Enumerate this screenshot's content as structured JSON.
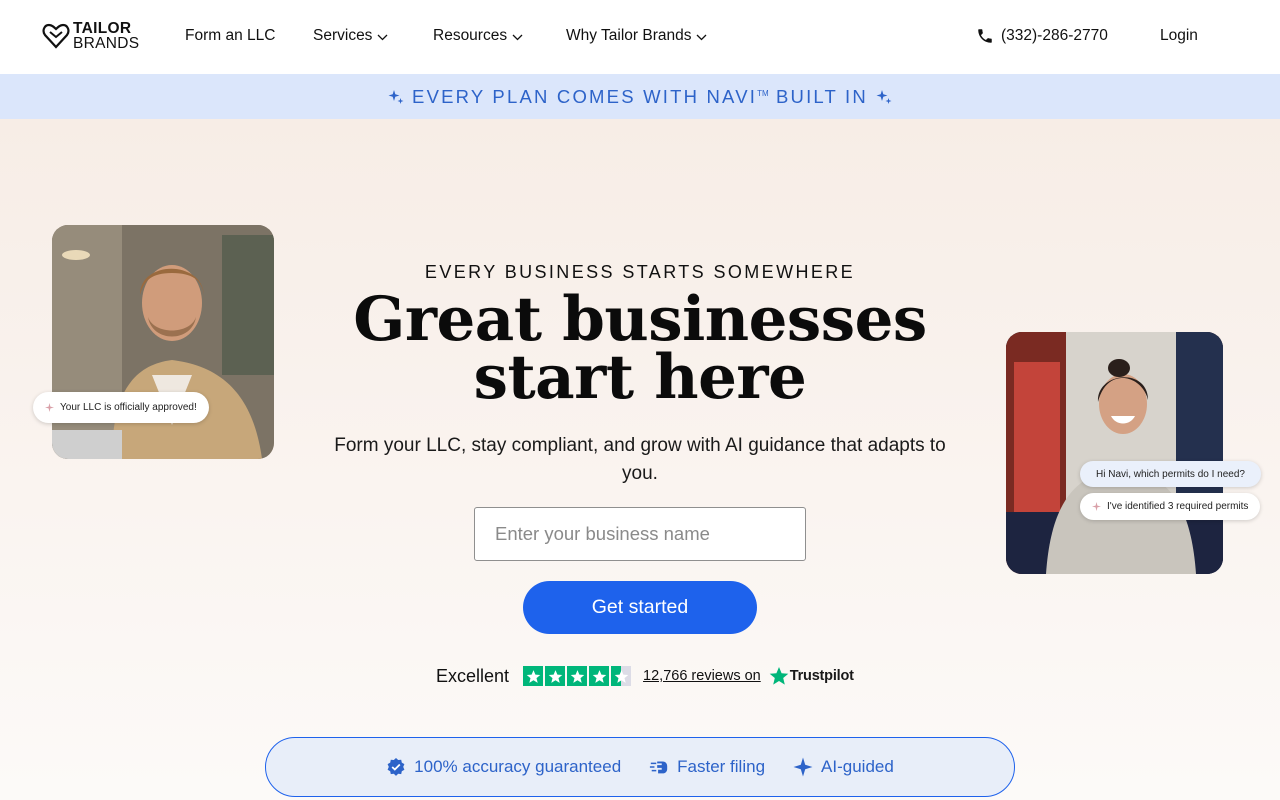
{
  "nav": {
    "logo_line1": "TAILOR",
    "logo_line2": "BRANDS",
    "items": [
      {
        "label": "Form an LLC"
      },
      {
        "label": "Services"
      },
      {
        "label": "Resources"
      },
      {
        "label": "Why Tailor Brands"
      }
    ],
    "phone": "(332)-286-2770",
    "login": "Login"
  },
  "banner": {
    "text": "EVERY PLAN COMES WITH NAVI",
    "tm": "TM",
    "text_after": " BUILT IN"
  },
  "hero": {
    "eyebrow": "EVERY BUSINESS STARTS SOMEWHERE",
    "headline_line1": "Great businesses",
    "headline_line2": "start here",
    "subhead": "Form your LLC, stay compliant, and grow with AI guidance that adapts to you.",
    "input_placeholder": "Enter your business name",
    "input_value": "",
    "cta": "Get started"
  },
  "rating": {
    "label": "Excellent",
    "stars": 4.5,
    "reviews": "12,766 reviews on",
    "brand": "Trustpilot"
  },
  "bubbles": {
    "left": "Your LLC is officially approved!",
    "right_question": "Hi Navi, which permits do I need?",
    "right_answer": "I've identified 3 required permits"
  },
  "badges": [
    {
      "label": "100% accuracy guaranteed",
      "icon": "verified-check-icon"
    },
    {
      "label": "Faster filing",
      "icon": "fast-hand-icon"
    },
    {
      "label": "AI-guided",
      "icon": "sparkle-icon"
    }
  ],
  "colors": {
    "accent": "#1e62ec",
    "banner_bg": "#dbe6fb",
    "banner_text": "#2d63c9",
    "trustpilot_green": "#00b67a"
  }
}
